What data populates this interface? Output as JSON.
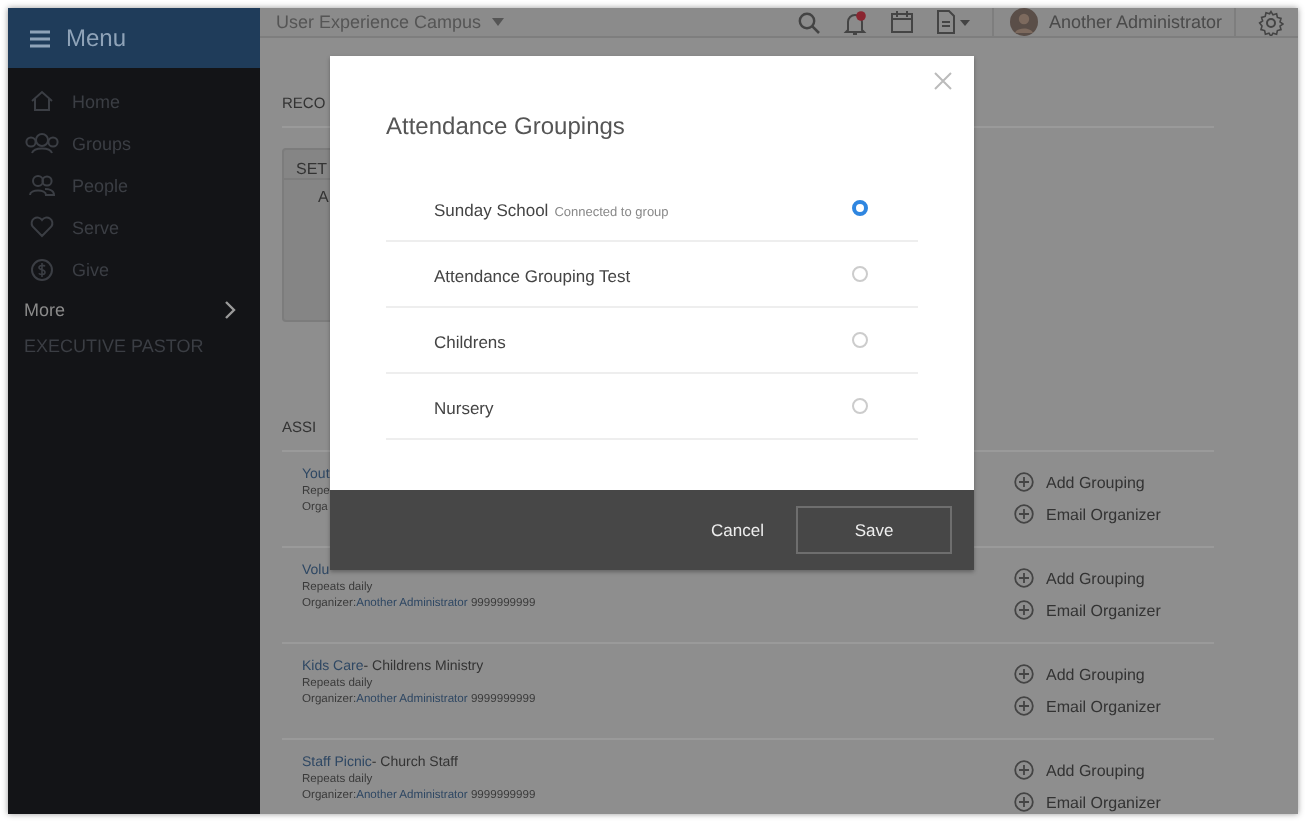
{
  "topbar": {
    "menu_label": "Menu",
    "campus": "User Experience Campus",
    "user": "Another Administrator",
    "notification": true
  },
  "sidebar": {
    "items": [
      {
        "label": "Home"
      },
      {
        "label": "Groups"
      },
      {
        "label": "People"
      },
      {
        "label": "Serve"
      },
      {
        "label": "Give"
      }
    ],
    "more": "More",
    "section": "EXECUTIVE PASTOR"
  },
  "background": {
    "heading_1": "RECO",
    "panel_header": "SET",
    "panel_text": "A",
    "heading_2": "ASSI"
  },
  "assignments": [
    {
      "title": "Yout",
      "repeats": "Repe",
      "organizer_label": "Orga",
      "actions": [
        "Add Grouping",
        "Email Organizer"
      ]
    },
    {
      "title": "Volu",
      "repeats": "Repeats daily",
      "organizer_label": "Organizer:",
      "organizer": "Another Administrator",
      "phone": "9999999999",
      "actions": [
        "Add Grouping",
        "Email Organizer"
      ]
    },
    {
      "title": "Kids Care",
      "subtitle": "- Childrens Ministry",
      "repeats": "Repeats daily",
      "organizer_label": "Organizer:",
      "organizer": "Another Administrator",
      "phone": "9999999999",
      "actions": [
        "Add Grouping",
        "Email Organizer"
      ]
    },
    {
      "title": "Staff Picnic",
      "subtitle": "- Church Staff",
      "repeats": "Repeats daily",
      "organizer_label": "Organizer:",
      "organizer": "Another Administrator",
      "phone": "9999999999",
      "actions": [
        "Add Grouping",
        "Email Organizer"
      ]
    }
  ],
  "modal": {
    "title": "Attendance Groupings",
    "options": [
      {
        "label": "Sunday School",
        "note": "Connected to group",
        "selected": true
      },
      {
        "label": "Attendance Grouping Test",
        "selected": false
      },
      {
        "label": "Childrens",
        "selected": false
      },
      {
        "label": "Nursery",
        "selected": false
      }
    ],
    "cancel": "Cancel",
    "save": "Save"
  }
}
